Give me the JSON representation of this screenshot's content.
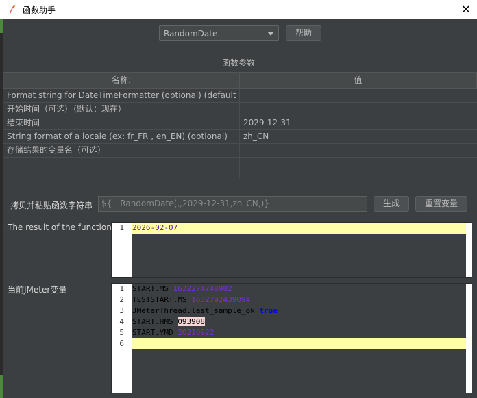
{
  "window": {
    "title": "函数助手",
    "close_glyph": "✕"
  },
  "function_select": {
    "selected": "RandomDate"
  },
  "help_button": "帮助",
  "params_section_title": "函数参数",
  "table": {
    "headers": {
      "name": "名称:",
      "value": "值"
    },
    "rows": [
      {
        "name": "Format string for DateTimeFormatter (optional) (default yyyy-...",
        "value": ""
      },
      {
        "name": "开始时间（可选）（默认：现在）",
        "value": ""
      },
      {
        "name": "结束时间",
        "value": "2029-12-31"
      },
      {
        "name": "String format of a locale (ex: fr_FR , en_EN) (optional)",
        "value": "zh_CN"
      },
      {
        "name": "存储结果的变量名（可选）",
        "value": ""
      }
    ]
  },
  "copy": {
    "label": "拷贝并粘贴函数字符串",
    "value": "${__RandomDate(,,2029-12-31,zh_CN,)}",
    "generate_button": "生成",
    "reset_button": "重置变量"
  },
  "result": {
    "label": "The result of the function is",
    "lines": [
      {
        "n": "1",
        "text": "2026-02-07"
      }
    ]
  },
  "vars": {
    "label": "当前JMeter变量",
    "lines": [
      {
        "n": "1",
        "key": "START.MS ",
        "value": "1632274748982"
      },
      {
        "n": "2",
        "key": "TESTSTART.MS ",
        "value": "1632792439094"
      },
      {
        "n": "3",
        "key": "JMeterThread.last_sample_ok ",
        "value": "true"
      },
      {
        "n": "4",
        "key": "START.HMS ",
        "value": "093908"
      },
      {
        "n": "5",
        "key": "START.YMD ",
        "value": "20210922"
      },
      {
        "n": "6",
        "key": "",
        "value": ""
      }
    ]
  },
  "colors": {
    "background": "#3c3f41",
    "current_line": "#ffffaa",
    "value_purple": "#7b2fd0",
    "keyword_blue": "#0000ff"
  }
}
